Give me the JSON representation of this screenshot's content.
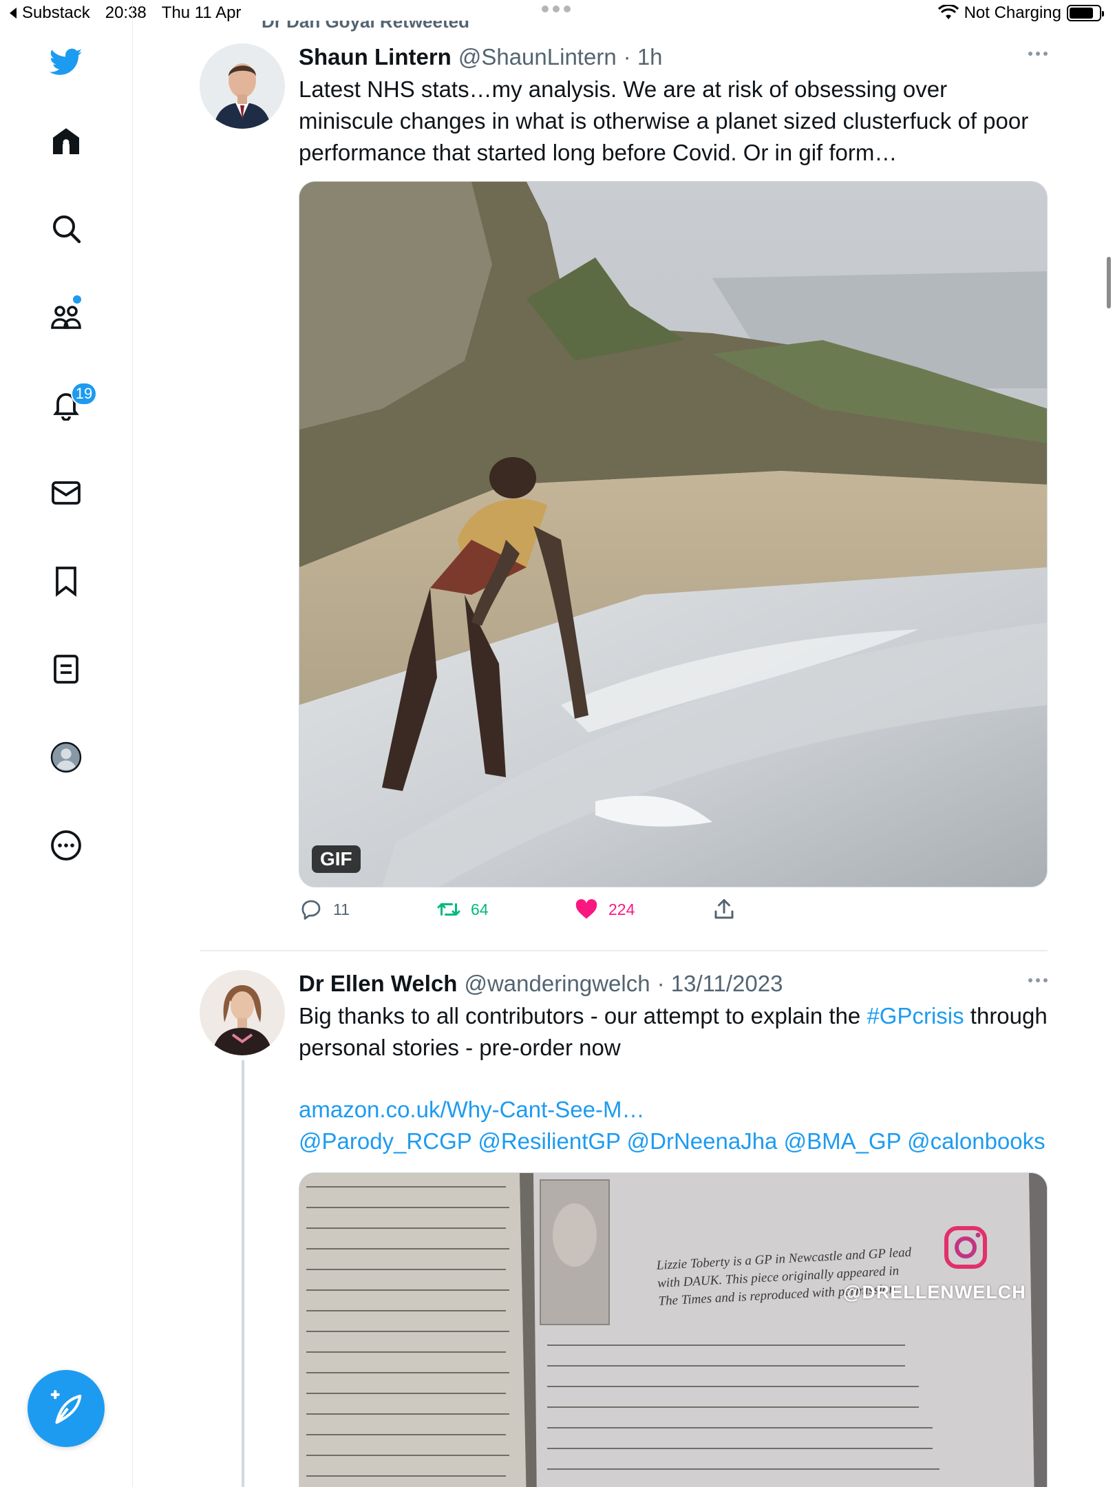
{
  "status_bar": {
    "back_app": "Substack",
    "time": "20:38",
    "date": "Thu 11 Apr",
    "charging": "Not Charging",
    "battery_level": 0.85
  },
  "sidebar": {
    "items": [
      {
        "icon": "twitter-bird-icon"
      },
      {
        "icon": "home-icon"
      },
      {
        "icon": "search-icon"
      },
      {
        "icon": "communities-icon"
      },
      {
        "icon": "notifications-icon",
        "badge": "19"
      },
      {
        "icon": "messages-icon"
      },
      {
        "icon": "bookmarks-icon"
      },
      {
        "icon": "lists-icon"
      },
      {
        "icon": "profile-icon"
      },
      {
        "icon": "more-icon"
      }
    ],
    "compose_icon": "compose-tweet-icon"
  },
  "retweet_context": "Dr Dan Goyal Retweeted",
  "tweets": [
    {
      "name": "Shaun Lintern",
      "handle": "@ShaunLintern",
      "time": "· 1h",
      "text": "Latest NHS stats…my analysis. We are at risk of obsessing over miniscule changes in what is otherwise a planet sized clusterfuck of poor performance that started long before Covid. Or in gif form…",
      "media_label": "GIF",
      "replies": "11",
      "retweets": "64",
      "likes": "224"
    },
    {
      "name": "Dr Ellen Welch",
      "handle": "@wanderingwelch",
      "time": "· 13/11/2023",
      "text_before": "Big thanks to all contributors - our attempt to explain the ",
      "hashtag": "#GPcrisis",
      "text_after": " through personal stories - pre-order now",
      "link": "amazon.co.uk/Why-Cant-See-M…",
      "mentions": "@Parody_RCGP @ResilientGP @DrNeenaJha @BMA_GP @calonbooks",
      "media_watermark": "@DRELLENWELCH",
      "media_caption": "Lizzie Toberty is a GP in Newcastle and GP lead with DAUK. This piece originally appeared in The Times and is reproduced with permission."
    }
  ],
  "colors": {
    "accent": "#1d9bf0",
    "retweet": "#00ba7c",
    "like": "#f91880",
    "muted": "#536471"
  }
}
